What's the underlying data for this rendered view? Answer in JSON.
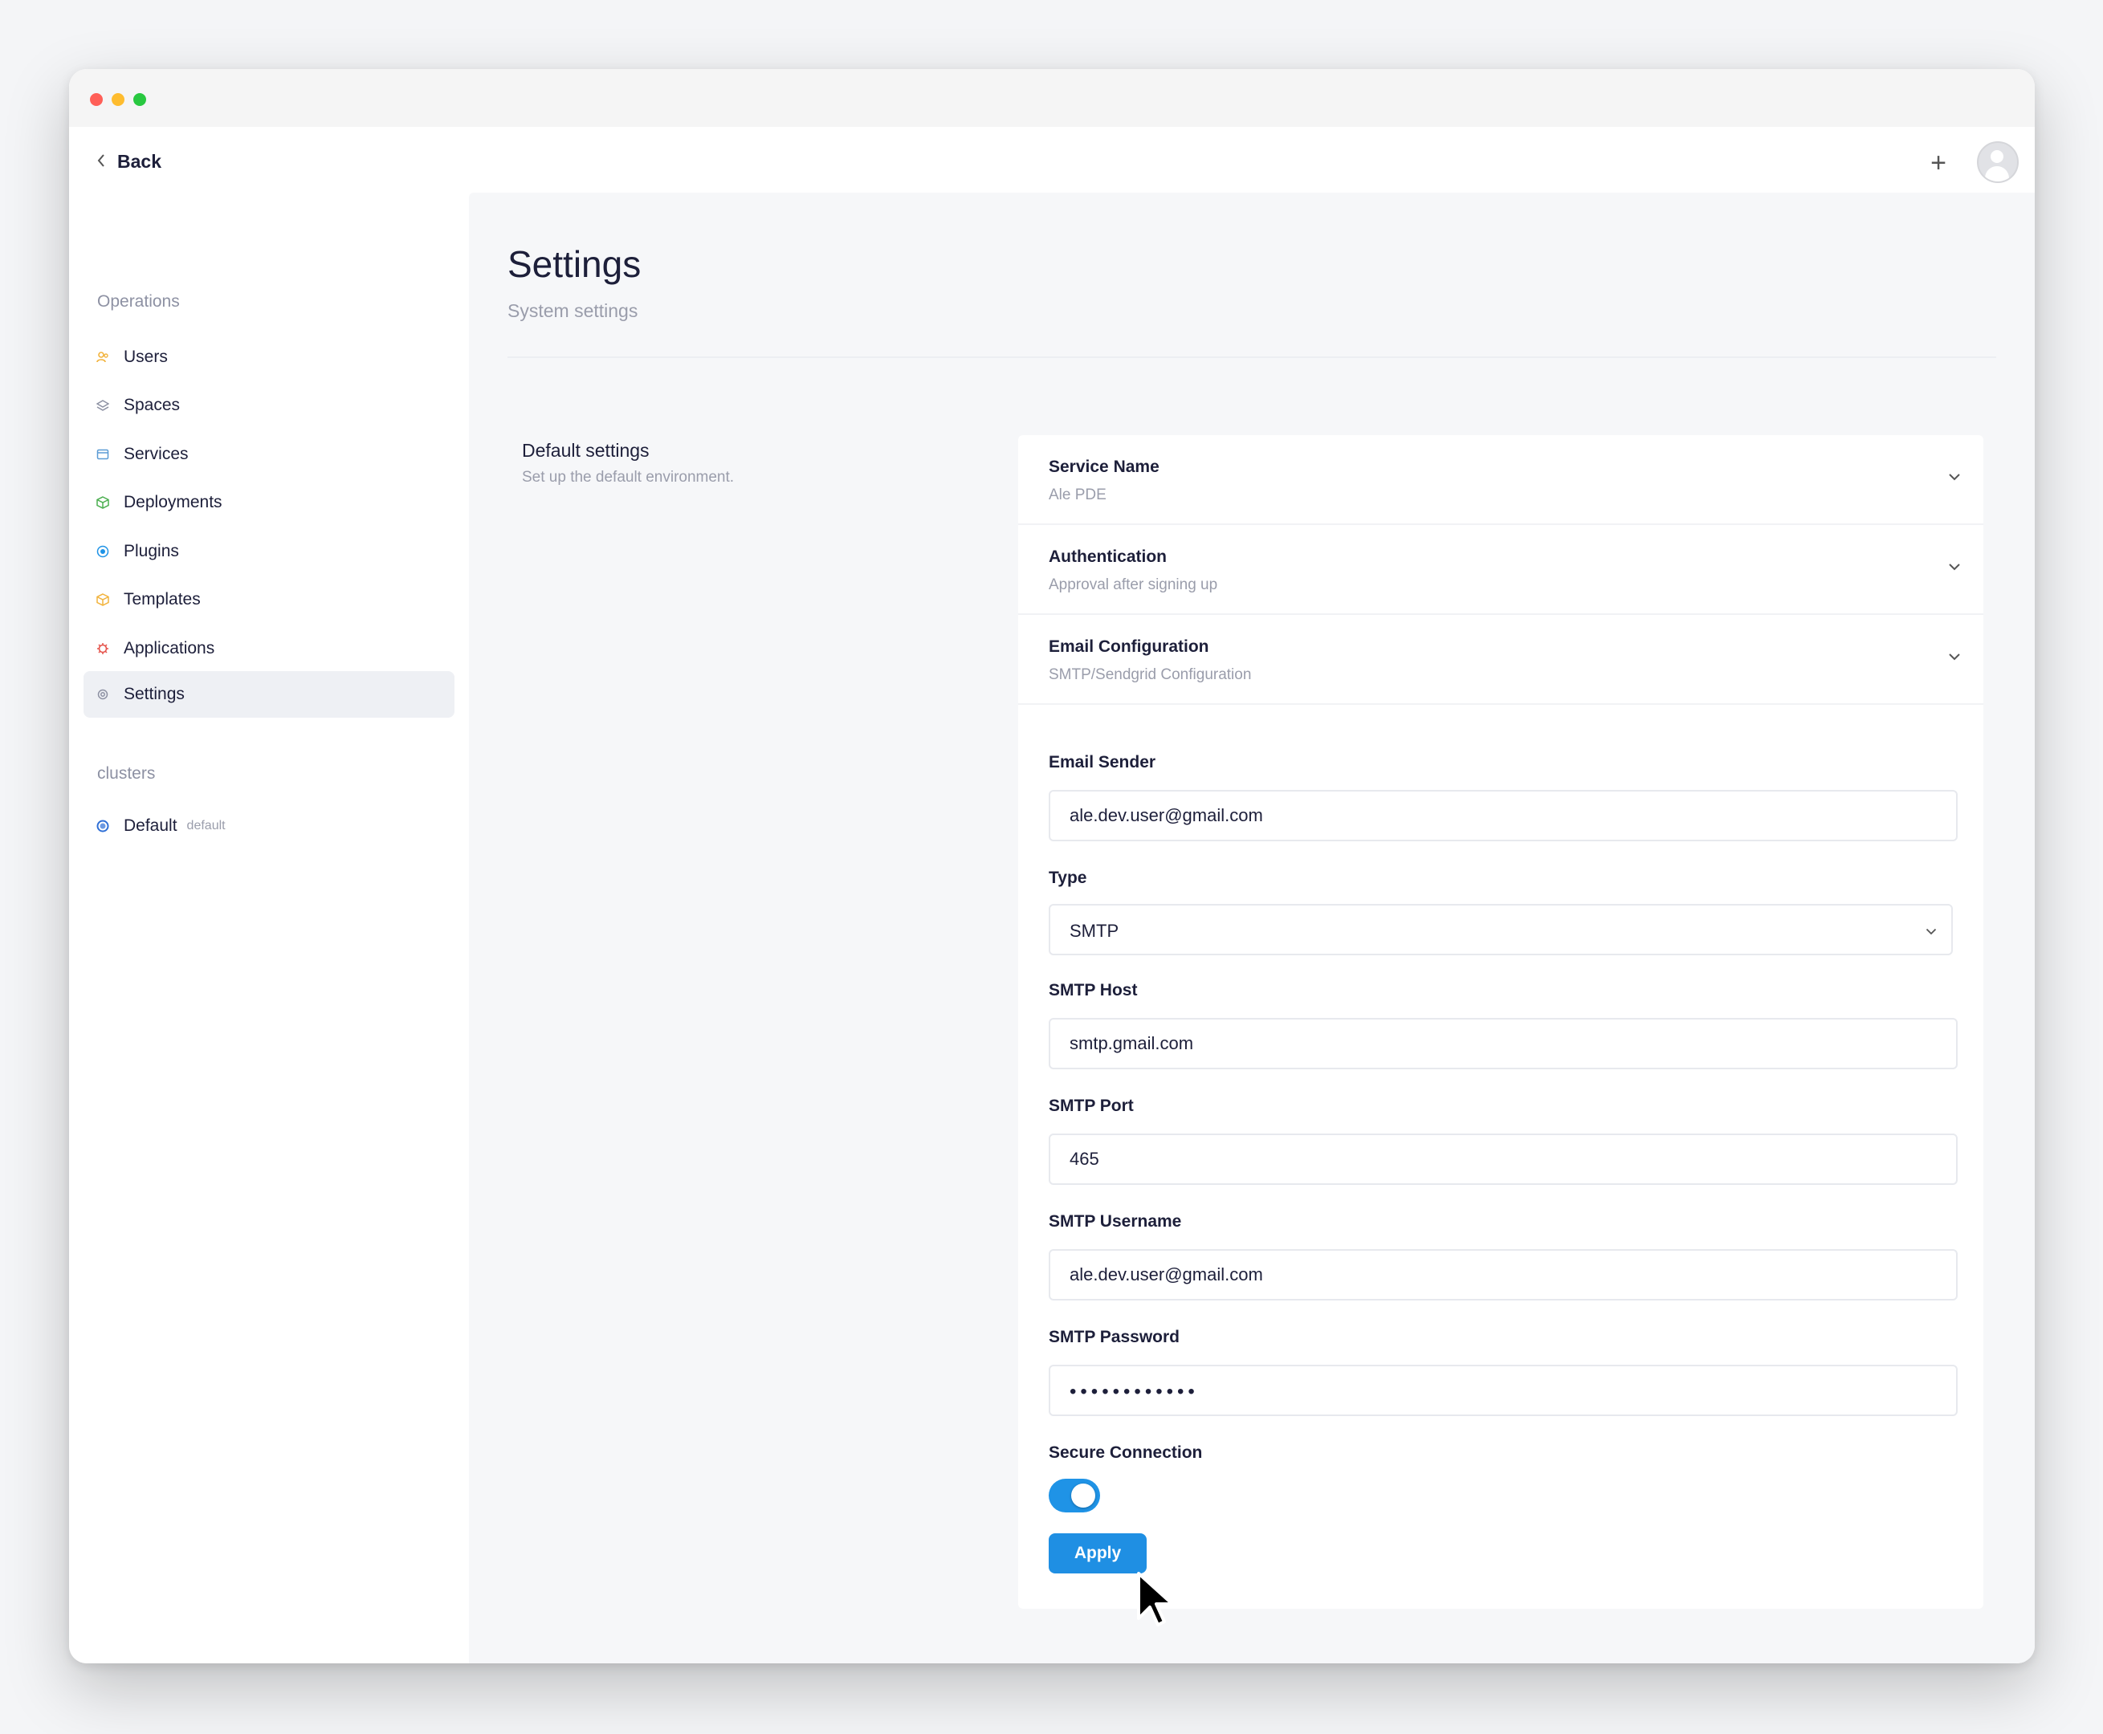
{
  "header": {
    "back_label": "Back",
    "plus_label": "+"
  },
  "sidebar": {
    "operations_label": "Operations",
    "items": [
      {
        "label": "Users",
        "icon": "users-icon",
        "color": "#f2b33d"
      },
      {
        "label": "Spaces",
        "icon": "spaces-icon",
        "color": "#8d91a3"
      },
      {
        "label": "Services",
        "icon": "services-icon",
        "color": "#5b9bd5"
      },
      {
        "label": "Deployments",
        "icon": "deployments-icon",
        "color": "#4caf50"
      },
      {
        "label": "Plugins",
        "icon": "plugins-icon",
        "color": "#1f93e6"
      },
      {
        "label": "Templates",
        "icon": "templates-icon",
        "color": "#f2b33d"
      },
      {
        "label": "Applications",
        "icon": "applications-icon",
        "color": "#e5534b"
      },
      {
        "label": "Settings",
        "icon": "settings-icon",
        "color": "#8d91a3",
        "active": true
      }
    ],
    "clusters_label": "clusters",
    "cluster": {
      "label": "Default",
      "badge": "default",
      "icon": "cluster-icon",
      "color": "#2f6fd6"
    }
  },
  "page": {
    "title": "Settings",
    "subtitle": "System settings"
  },
  "section": {
    "title": "Default settings",
    "description": "Set up the default environment."
  },
  "accordion": [
    {
      "title": "Service Name",
      "subtitle": "Ale PDE"
    },
    {
      "title": "Authentication",
      "subtitle": "Approval after signing up"
    },
    {
      "title": "Email Configuration",
      "subtitle": "SMTP/Sendgrid Configuration"
    }
  ],
  "form": {
    "email_sender": {
      "label": "Email Sender",
      "value": "ale.dev.user@gmail.com"
    },
    "type": {
      "label": "Type",
      "value": "SMTP"
    },
    "smtp_host": {
      "label": "SMTP Host",
      "value": "smtp.gmail.com"
    },
    "smtp_port": {
      "label": "SMTP Port",
      "value": "465"
    },
    "smtp_username": {
      "label": "SMTP Username",
      "value": "ale.dev.user@gmail.com"
    },
    "smtp_password": {
      "label": "SMTP Password",
      "value": "••••••••••••"
    },
    "secure_connection": {
      "label": "Secure Connection",
      "enabled": true
    },
    "apply_label": "Apply"
  },
  "colors": {
    "accent": "#1f8fe3",
    "toggle_on": "#1f93e6"
  }
}
